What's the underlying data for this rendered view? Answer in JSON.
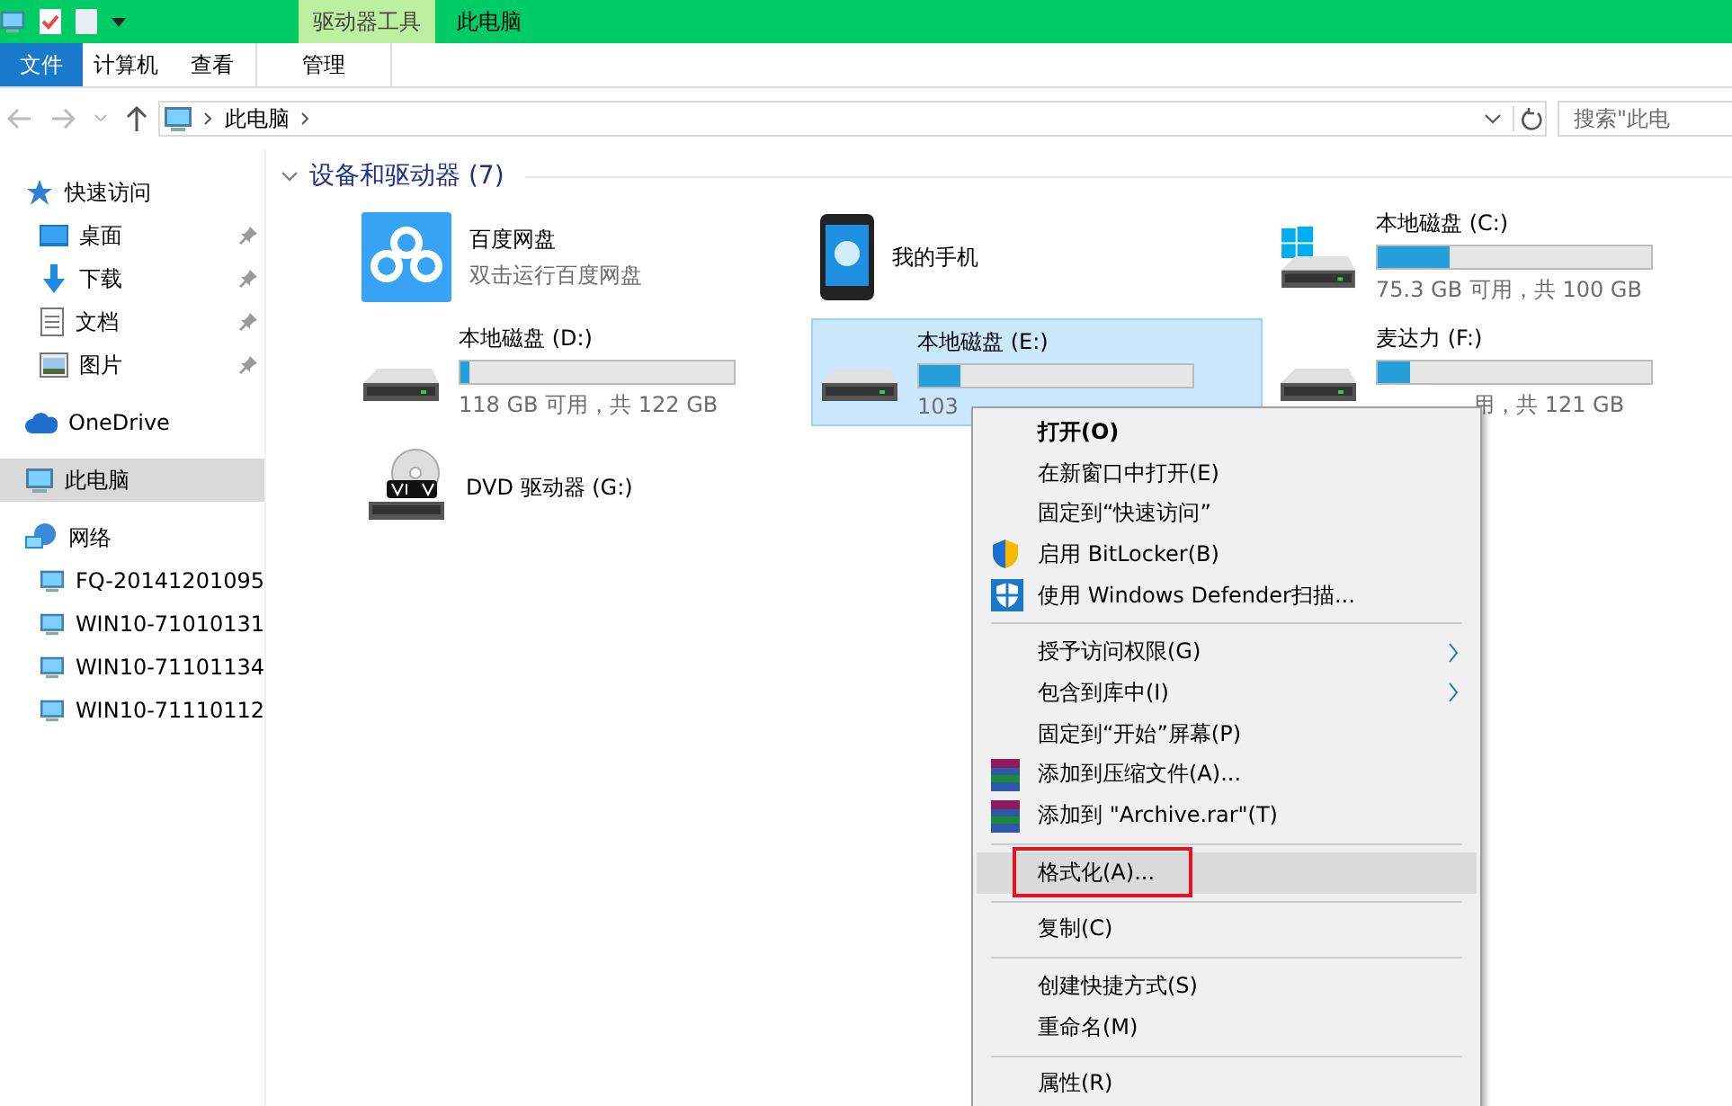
{
  "title_bar": {
    "context_tab": "驱动器工具",
    "title": "此电脑"
  },
  "ribbon_tabs": [
    {
      "label": "文件",
      "kind": "file",
      "selected": false
    },
    {
      "label": "计算机",
      "kind": "tab",
      "selected": false
    },
    {
      "label": "查看",
      "kind": "tab",
      "selected": false
    },
    {
      "label": "管理",
      "kind": "context",
      "selected": false
    }
  ],
  "address_bar": {
    "path": [
      "此电脑"
    ],
    "search": {
      "placeholder": "搜索\"此电"
    }
  },
  "sidebar": {
    "items": [
      {
        "label": "快速访问",
        "selected": false,
        "children": [
          {
            "label": "桌面",
            "pinned": true,
            "selected": false
          },
          {
            "label": "下载",
            "pinned": true,
            "selected": false
          },
          {
            "label": "文档",
            "pinned": true,
            "selected": false
          },
          {
            "label": "图片",
            "pinned": true,
            "selected": false
          }
        ]
      },
      {
        "label": "OneDrive",
        "selected": false
      },
      {
        "label": "此电脑",
        "selected": true
      },
      {
        "label": "网络",
        "selected": false,
        "children": [
          {
            "label": "FQ-20141201095",
            "pinned": false,
            "selected": false
          },
          {
            "label": "WIN10-71010131",
            "pinned": false,
            "selected": false
          },
          {
            "label": "WIN10-71101134",
            "pinned": false,
            "selected": false
          },
          {
            "label": "WIN10-71110112",
            "pinned": false,
            "selected": false
          }
        ]
      }
    ]
  },
  "group": {
    "title": "设备和驱动器 (7)",
    "expanded": true
  },
  "devices": [
    {
      "name": "百度网盘",
      "kind": "app",
      "detail": "双击运行百度网盘",
      "selected": false
    },
    {
      "name": "我的手机",
      "kind": "app",
      "selected": false
    },
    {
      "name": "本地磁盘 (C:)",
      "kind": "drive",
      "level": 0.26,
      "detail": "75.3 GB 可用，共 100 GB",
      "selected": false
    },
    {
      "name": "本地磁盘 (D:)",
      "kind": "drive",
      "level": 0.03,
      "detail": "118 GB 可用，共 122 GB",
      "selected": false
    },
    {
      "name": "本地磁盘 (E:)",
      "kind": "drive",
      "level": 0.15,
      "detail": "103",
      "selected": true
    },
    {
      "name": "麦达力 (F:)",
      "kind": "drive",
      "level": 0.12,
      "detail": "用，共 121 GB",
      "selected": false
    },
    {
      "name": "DVD 驱动器 (G:)",
      "kind": "app",
      "selected": false
    }
  ],
  "context_menu": {
    "items": [
      {
        "kind": "item",
        "label": "打开(O)",
        "bold": true
      },
      {
        "kind": "item",
        "label": "在新窗口中打开(E)"
      },
      {
        "kind": "item",
        "label": "固定到“快速访问”"
      },
      {
        "kind": "item",
        "label": "启用 BitLocker(B)"
      },
      {
        "kind": "item",
        "label": "使用 Windows Defender扫描..."
      },
      {
        "kind": "separator"
      },
      {
        "kind": "item",
        "label": "授予访问权限(G)",
        "submenu": true
      },
      {
        "kind": "item",
        "label": "包含到库中(I)",
        "submenu": true
      },
      {
        "kind": "item",
        "label": "固定到“开始”屏幕(P)"
      },
      {
        "kind": "item",
        "label": "添加到压缩文件(A)..."
      },
      {
        "kind": "item",
        "label": "添加到 \"Archive.rar\"(T)"
      },
      {
        "kind": "separator"
      },
      {
        "kind": "item",
        "label": "格式化(A)...",
        "selected": true,
        "marked": true
      },
      {
        "kind": "separator"
      },
      {
        "kind": "item",
        "label": "复制(C)"
      },
      {
        "kind": "separator"
      },
      {
        "kind": "item",
        "label": "创建快捷方式(S)"
      },
      {
        "kind": "item",
        "label": "重命名(M)"
      },
      {
        "kind": "separator"
      },
      {
        "kind": "item",
        "label": "属性(R)"
      }
    ]
  }
}
